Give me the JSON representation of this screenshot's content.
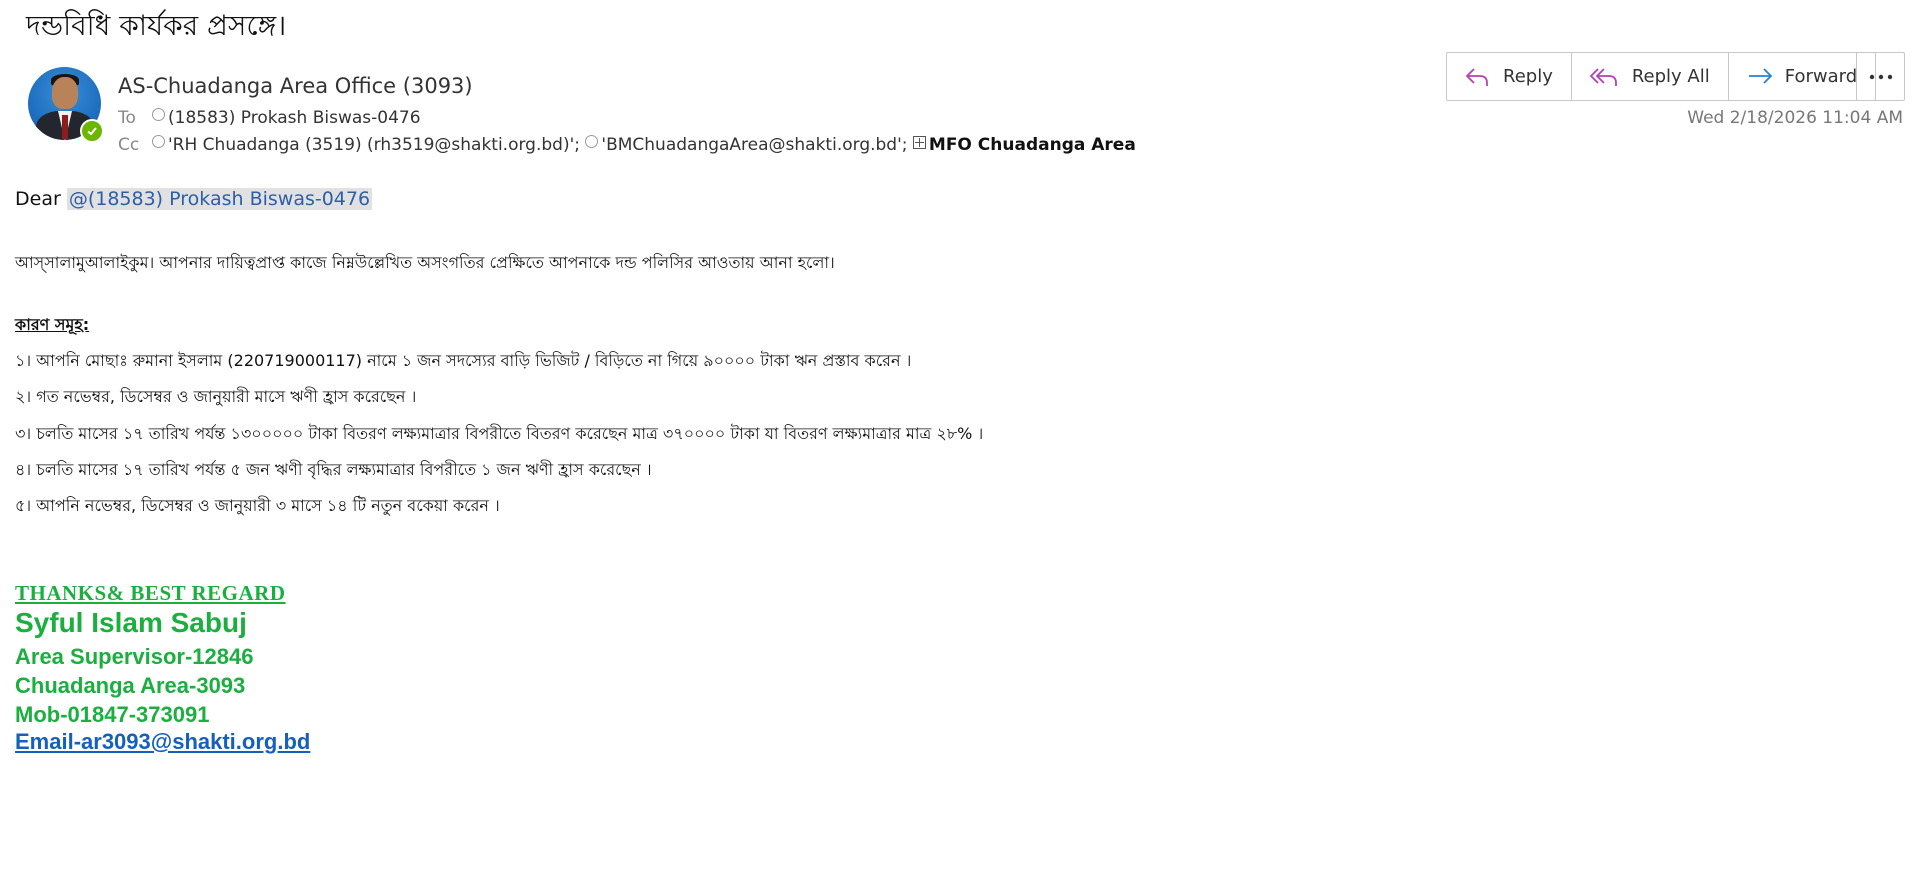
{
  "email": {
    "subject": "দন্ডবিধি কার্যকর প্রসঙ্গে।",
    "sender": "AS-Chuadanga Area Office (3093)",
    "to_label": "To",
    "to": "(18583) Prokash Biswas-0476",
    "cc_label": "Cc",
    "cc": [
      "'RH Chuadanga (3519) (rh3519@shakti.org.bd)';",
      "'BMChuadangaArea@shakti.org.bd';",
      "MFO Chuadanga Area"
    ],
    "date": "Wed 2/18/2026 11:04 AM"
  },
  "actions": {
    "reply": "Reply",
    "reply_all": "Reply All",
    "forward": "Forward",
    "more": "···"
  },
  "body": {
    "dear": "Dear",
    "mention": "@(18583) Prokash Biswas-0476",
    "greeting": "আস্সালামুআলাইকুম।  আপনার দায়িত্বপ্রাপ্ত কাজে নিম্নউল্লেখিত অসংগতির প্রেক্ষিতে আপনাকে দন্ড পলিসির আওতায় আনা হলো।",
    "reasons_heading": "কারণ সমূহ:",
    "reasons": [
      "১।  আপনি মোছাঃ রুমানা ইসলাম (220719000117) নামে ১ জন সদস্যের বাড়ি ভিজিট / বিড়িতে না গিয়ে ৯০০০০ টাকা ঋন প্রস্তাব করেন ।",
      "২।  গত নভেম্বর, ডিসেম্বর ও জানুয়ারী মাসে ঋণী হ্রাস করেছেন ।",
      "৩।  চলতি মাসের ১৭ তারিখ পর্যন্ত ১৩০০০০০ টাকা বিতরণ লক্ষ্যমাত্রার বিপরীতে বিতরণ করেছেন মাত্র ৩৭০০০০ টাকা যা বিতরণ লক্ষ্যমাত্রার মাত্র ২৮% ।",
      "৪।  চলতি মাসের ১৭ তারিখ পর্যন্ত ৫ জন ঋণী বৃদ্ধির লক্ষ্যমাত্রার বিপরীতে ১ জন ঋণী হ্রাস করেছেন ।",
      "৫। আপনি নভেম্বর, ডিসেম্বর ও জানুয়ারী ৩ মাসে ১৪ টি নতুন বকেয়া করেন ।"
    ]
  },
  "signature": {
    "thanks": "THANKS& BEST REGARD",
    "name": "Syful Islam Sabuj",
    "title": "Area Supervisor-12846",
    "area": "Chuadanga Area-3093",
    "mobile": "Mob-01847-373091",
    "email": "Email-ar3093@shakti.org.bd"
  },
  "colors": {
    "signature_green": "#1aaf3f",
    "link_blue": "#1560bd",
    "reply_all_icon": "#b63fb8",
    "forward_icon": "#2a7fd4",
    "presence": "#6bb700"
  }
}
